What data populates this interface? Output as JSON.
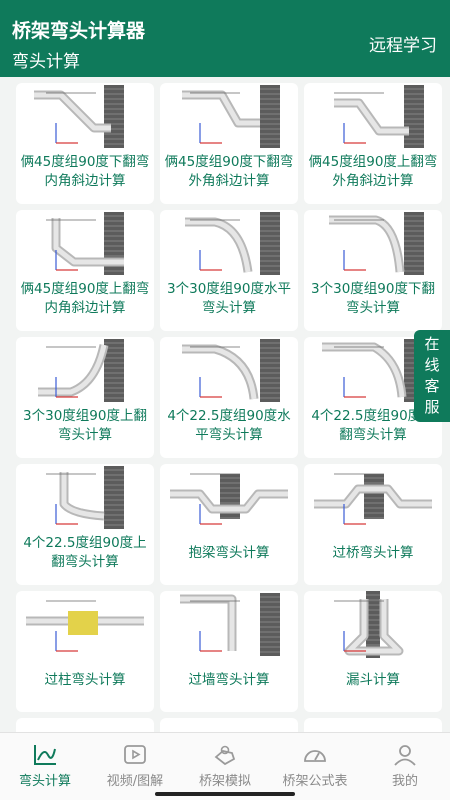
{
  "header": {
    "app_title": "桥架弯头计算器",
    "sub_title": "弯头计算",
    "remote_link": "远程学习"
  },
  "cards": [
    {
      "label": "俩45度组90度下翻弯内角斜边计算",
      "icon": "cable-tray-elbow-diagram"
    },
    {
      "label": "俩45度组90度下翻弯外角斜边计算",
      "icon": "cable-tray-elbow-diagram"
    },
    {
      "label": "俩45度组90度上翻弯外角斜边计算",
      "icon": "cable-tray-elbow-diagram"
    },
    {
      "label": "俩45度组90度上翻弯内角斜边计算",
      "icon": "cable-tray-elbow-diagram"
    },
    {
      "label": "3个30度组90度水平弯头计算",
      "icon": "cable-tray-elbow-diagram"
    },
    {
      "label": "3个30度组90度下翻弯头计算",
      "icon": "cable-tray-elbow-diagram"
    },
    {
      "label": "3个30度组90度上翻弯头计算",
      "icon": "cable-tray-elbow-diagram"
    },
    {
      "label": "4个22.5度组90度水平弯头计算",
      "icon": "cable-tray-elbow-diagram"
    },
    {
      "label": "4个22.5度组90度下翻弯头计算",
      "icon": "cable-tray-elbow-diagram"
    },
    {
      "label": "4个22.5度组90度上翻弯头计算",
      "icon": "cable-tray-elbow-diagram"
    },
    {
      "label": "抱梁弯头计算",
      "icon": "beam-wrap-diagram"
    },
    {
      "label": "过桥弯头计算",
      "icon": "bridge-cross-diagram"
    },
    {
      "label": "过柱弯头计算",
      "icon": "column-cross-diagram"
    },
    {
      "label": "过墙弯头计算",
      "icon": "wall-cross-diagram"
    },
    {
      "label": "漏斗计算",
      "icon": "funnel-diagram"
    }
  ],
  "float_service": [
    "在",
    "线",
    "客",
    "服"
  ],
  "tabs": [
    {
      "label": "弯头计算",
      "icon": "elbow-calc-icon",
      "active": true
    },
    {
      "label": "视频/图解",
      "icon": "video-icon",
      "active": false
    },
    {
      "label": "桥架模拟",
      "icon": "simulation-icon",
      "active": false
    },
    {
      "label": "桥架公式表",
      "icon": "gauge-icon",
      "active": false
    },
    {
      "label": "我的",
      "icon": "profile-icon",
      "active": false
    }
  ],
  "colors": {
    "brand": "#0f7a5b",
    "background": "#f2f4f3",
    "tab_inactive": "#8a8a8a"
  }
}
